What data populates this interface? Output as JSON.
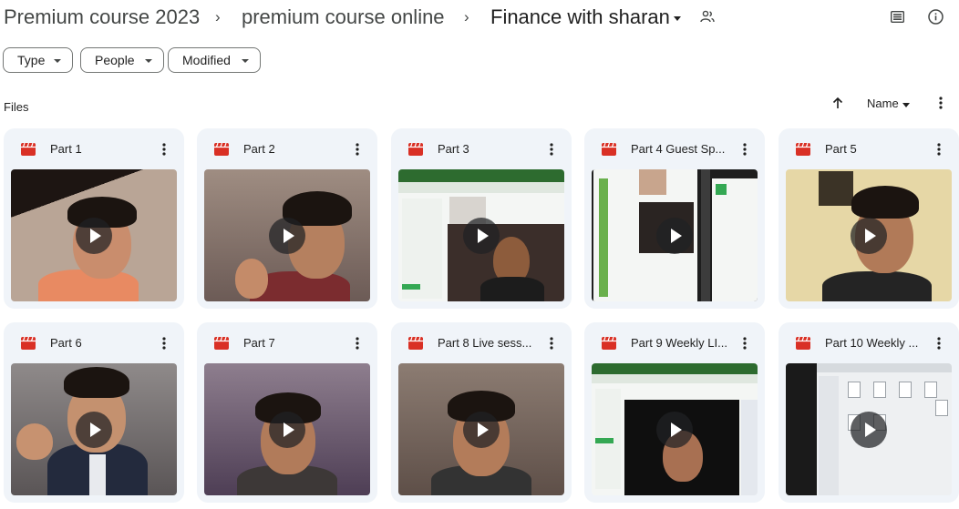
{
  "breadcrumb": {
    "items": [
      "Premium course 2023",
      "premium course online",
      "Finance with sharan"
    ],
    "separator": "›"
  },
  "toolbar": {
    "view_icon": "list-view-icon",
    "info_icon": "info-icon"
  },
  "filters": [
    {
      "label": "Type"
    },
    {
      "label": "People"
    },
    {
      "label": "Modified"
    }
  ],
  "section": {
    "label": "Files",
    "sort_label": "Name"
  },
  "files": [
    {
      "title": "Part 1"
    },
    {
      "title": "Part 2"
    },
    {
      "title": "Part 3"
    },
    {
      "title": "Part 4 Guest Sp..."
    },
    {
      "title": "Part 5"
    },
    {
      "title": "Part 6"
    },
    {
      "title": "Part 7"
    },
    {
      "title": "Part 8 Live sess..."
    },
    {
      "title": "Part 9 Weekly LI..."
    },
    {
      "title": "Part 10 Weekly ..."
    }
  ],
  "colors": {
    "card_bg": "#f0f4f9",
    "video_icon": "#d93025",
    "chip_border": "#747775"
  }
}
